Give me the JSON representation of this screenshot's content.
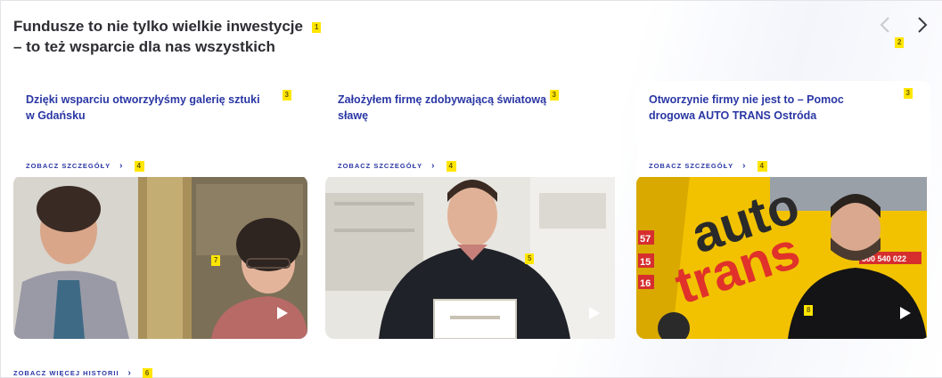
{
  "section": {
    "title_line1": "Fundusze to nie tylko wielkie inwestycje",
    "title_line2": "– to też wsparcie dla nas wszystkich"
  },
  "badges": {
    "title": "1",
    "nav": "2",
    "card_title": "3",
    "card_more": "4",
    "bottom_more": "6",
    "images": [
      "7",
      "5",
      "8"
    ]
  },
  "nav": {
    "prev_icon": "chevron-left-icon",
    "next_icon": "chevron-right-icon"
  },
  "cards": [
    {
      "title": "Dzięki wsparciu otworzyłyśmy galerię sztuki w Gdańsku",
      "more_label": "ZOBACZ SZCZEGÓŁY",
      "chevron": "›"
    },
    {
      "title": "Założyłem firmę zdobywającą światową sławę",
      "more_label": "ZOBACZ SZCZEGÓŁY",
      "chevron": "›"
    },
    {
      "title": "Otworzynie firmy nie jest to – Pomoc drogowa AUTO TRANS Ostróda",
      "more_label": "ZOBACZ SZCZEGÓŁY",
      "chevron": "›"
    }
  ],
  "truck": {
    "brand_1": "auto",
    "brand_2": "trans",
    "numbers": [
      "57",
      "15",
      "16"
    ],
    "phone": "500 540 022"
  },
  "bottom": {
    "more_label": "ZOBACZ WIĘCEJ HISTORII",
    "chevron": "›"
  },
  "colors": {
    "accent": "#2a37a4",
    "title": "#2d2d33",
    "badge": "#ffe600",
    "truck": "#f2c200"
  }
}
